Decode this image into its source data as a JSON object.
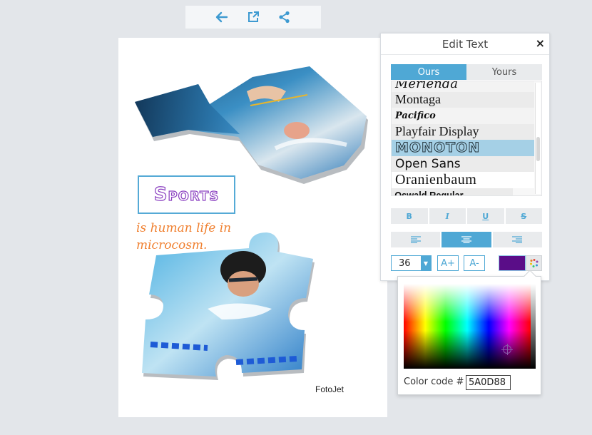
{
  "toolbar": {
    "buttons": [
      {
        "icon": "arrow-left-icon",
        "label": "Back"
      },
      {
        "icon": "external-link-icon",
        "label": "Open"
      },
      {
        "icon": "share-icon",
        "label": "Share"
      }
    ]
  },
  "canvas": {
    "heading": "Sports",
    "tagline": "is human life in microcosm.",
    "watermark": "FotoJet",
    "images": [
      "puzzle collage: swimmer and high jumper",
      "puzzle piece: butterfly swimmer"
    ]
  },
  "edit_panel": {
    "title": "Edit Text",
    "close_label": "×",
    "tabs": [
      {
        "label": "Ours",
        "active": true
      },
      {
        "label": "Yours",
        "active": false
      }
    ],
    "fonts": [
      {
        "label": "Merienda"
      },
      {
        "label": "Montaga"
      },
      {
        "label": "Pacifico"
      },
      {
        "label": "Playfair Display"
      },
      {
        "label": "MONOTON",
        "selected": true
      },
      {
        "label": "Open Sans"
      },
      {
        "label": "Oranienbaum"
      },
      {
        "label": "Oswald Regular"
      }
    ],
    "style_buttons": [
      {
        "label": "B",
        "name": "bold"
      },
      {
        "label": "I",
        "name": "italic"
      },
      {
        "label": "U",
        "name": "underline"
      },
      {
        "label": "S",
        "name": "strikethrough"
      }
    ],
    "align_buttons": [
      {
        "name": "align-left",
        "active": false
      },
      {
        "name": "align-center",
        "active": true
      },
      {
        "name": "align-right",
        "active": false
      }
    ],
    "font_size": "36",
    "increase_label": "A+",
    "decrease_label": "A-",
    "current_color": "#5A0D88"
  },
  "color_picker": {
    "code_label": "Color code #",
    "code_value": "5A0D88"
  },
  "colors": {
    "accent": "#4fa8d5",
    "selected_row": "#a5d0e6",
    "heading_text": "#8a3fc0",
    "tagline_text": "#f07f2e"
  }
}
